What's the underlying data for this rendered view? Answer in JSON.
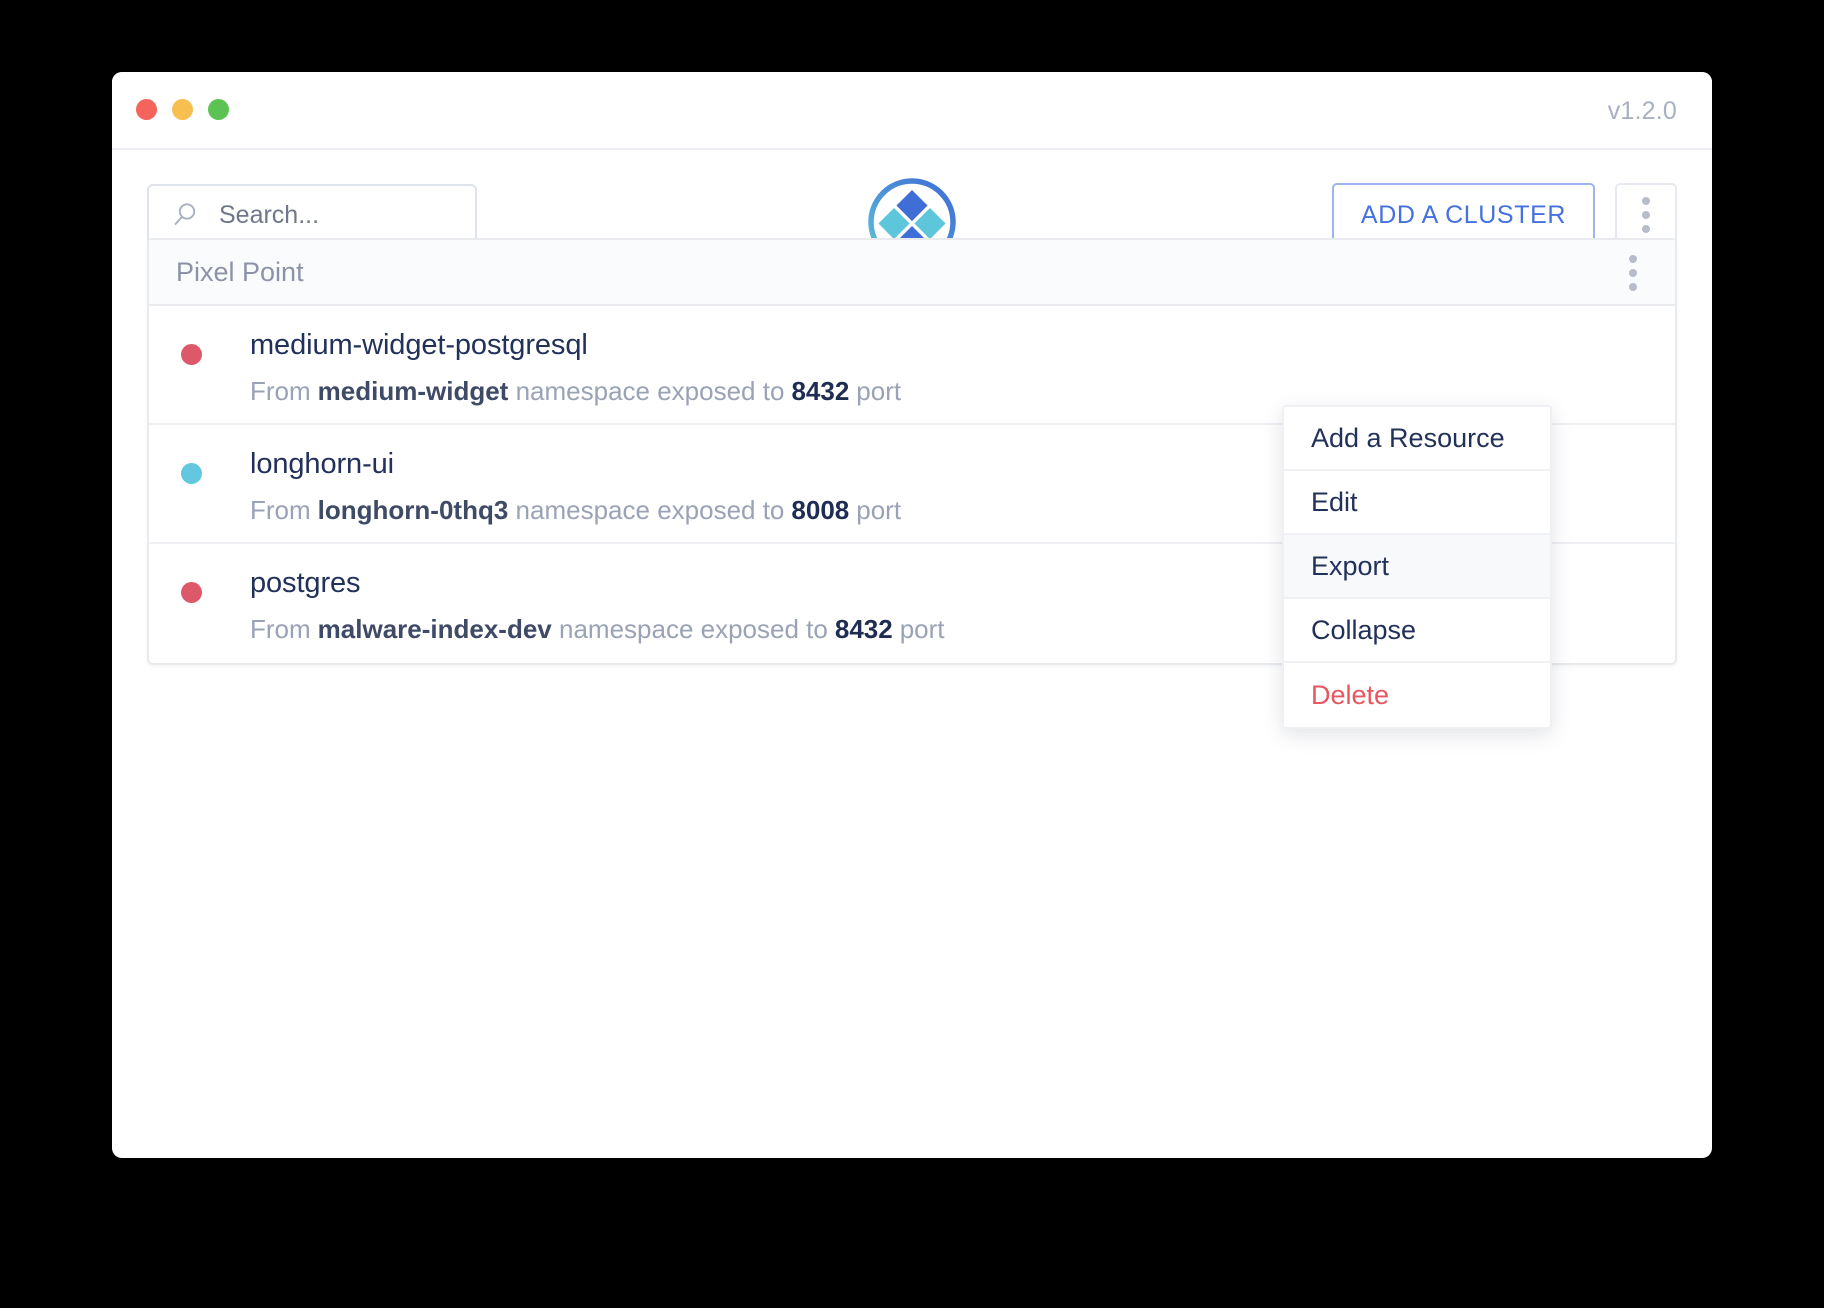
{
  "window": {
    "version_label": "v1.2.0",
    "traffic_lights": [
      "close",
      "minimize",
      "zoom"
    ]
  },
  "toolbar": {
    "search": {
      "placeholder": "Search...",
      "value": "",
      "icon": "search-icon"
    },
    "logo": {
      "icon": "app-logo-diamonds",
      "ring_color": "#4f9fd8",
      "diamond_blue": "#3f6ed6",
      "diamond_cyan": "#5ec6da"
    },
    "add_cluster_label": "ADD A CLUSTER",
    "overflow_icon": "kebab-menu-icon"
  },
  "cluster": {
    "title": "Pixel Point",
    "overflow_icon": "kebab-menu-icon",
    "resources": [
      {
        "name": "medium-widget-postgresql",
        "status_color": "#dd5868",
        "from_label": "From",
        "namespace": "medium-widget",
        "middle_label": "namespace exposed to",
        "port": "8432",
        "port_label": "port"
      },
      {
        "name": "longhorn-ui",
        "status_color": "#62c7df",
        "from_label": "From",
        "namespace": "longhorn-0thq3",
        "middle_label": "namespace exposed to",
        "port": "8008",
        "port_label": "port"
      },
      {
        "name": "postgres",
        "status_color": "#dd5868",
        "from_label": "From",
        "namespace": "malware-index-dev",
        "middle_label": "namespace exposed to",
        "port": "8432",
        "port_label": "port"
      }
    ]
  },
  "context_menu": {
    "items": [
      {
        "label": "Add a Resource",
        "state": "normal"
      },
      {
        "label": "Edit",
        "state": "normal"
      },
      {
        "label": "Export",
        "state": "hovered"
      },
      {
        "label": "Collapse",
        "state": "normal"
      },
      {
        "label": "Delete",
        "state": "danger"
      }
    ]
  },
  "colors": {
    "accent_blue": "#4571e0",
    "danger_red": "#e8575f",
    "text_dark": "#22315a",
    "text_muted": "#9aa2b5"
  }
}
